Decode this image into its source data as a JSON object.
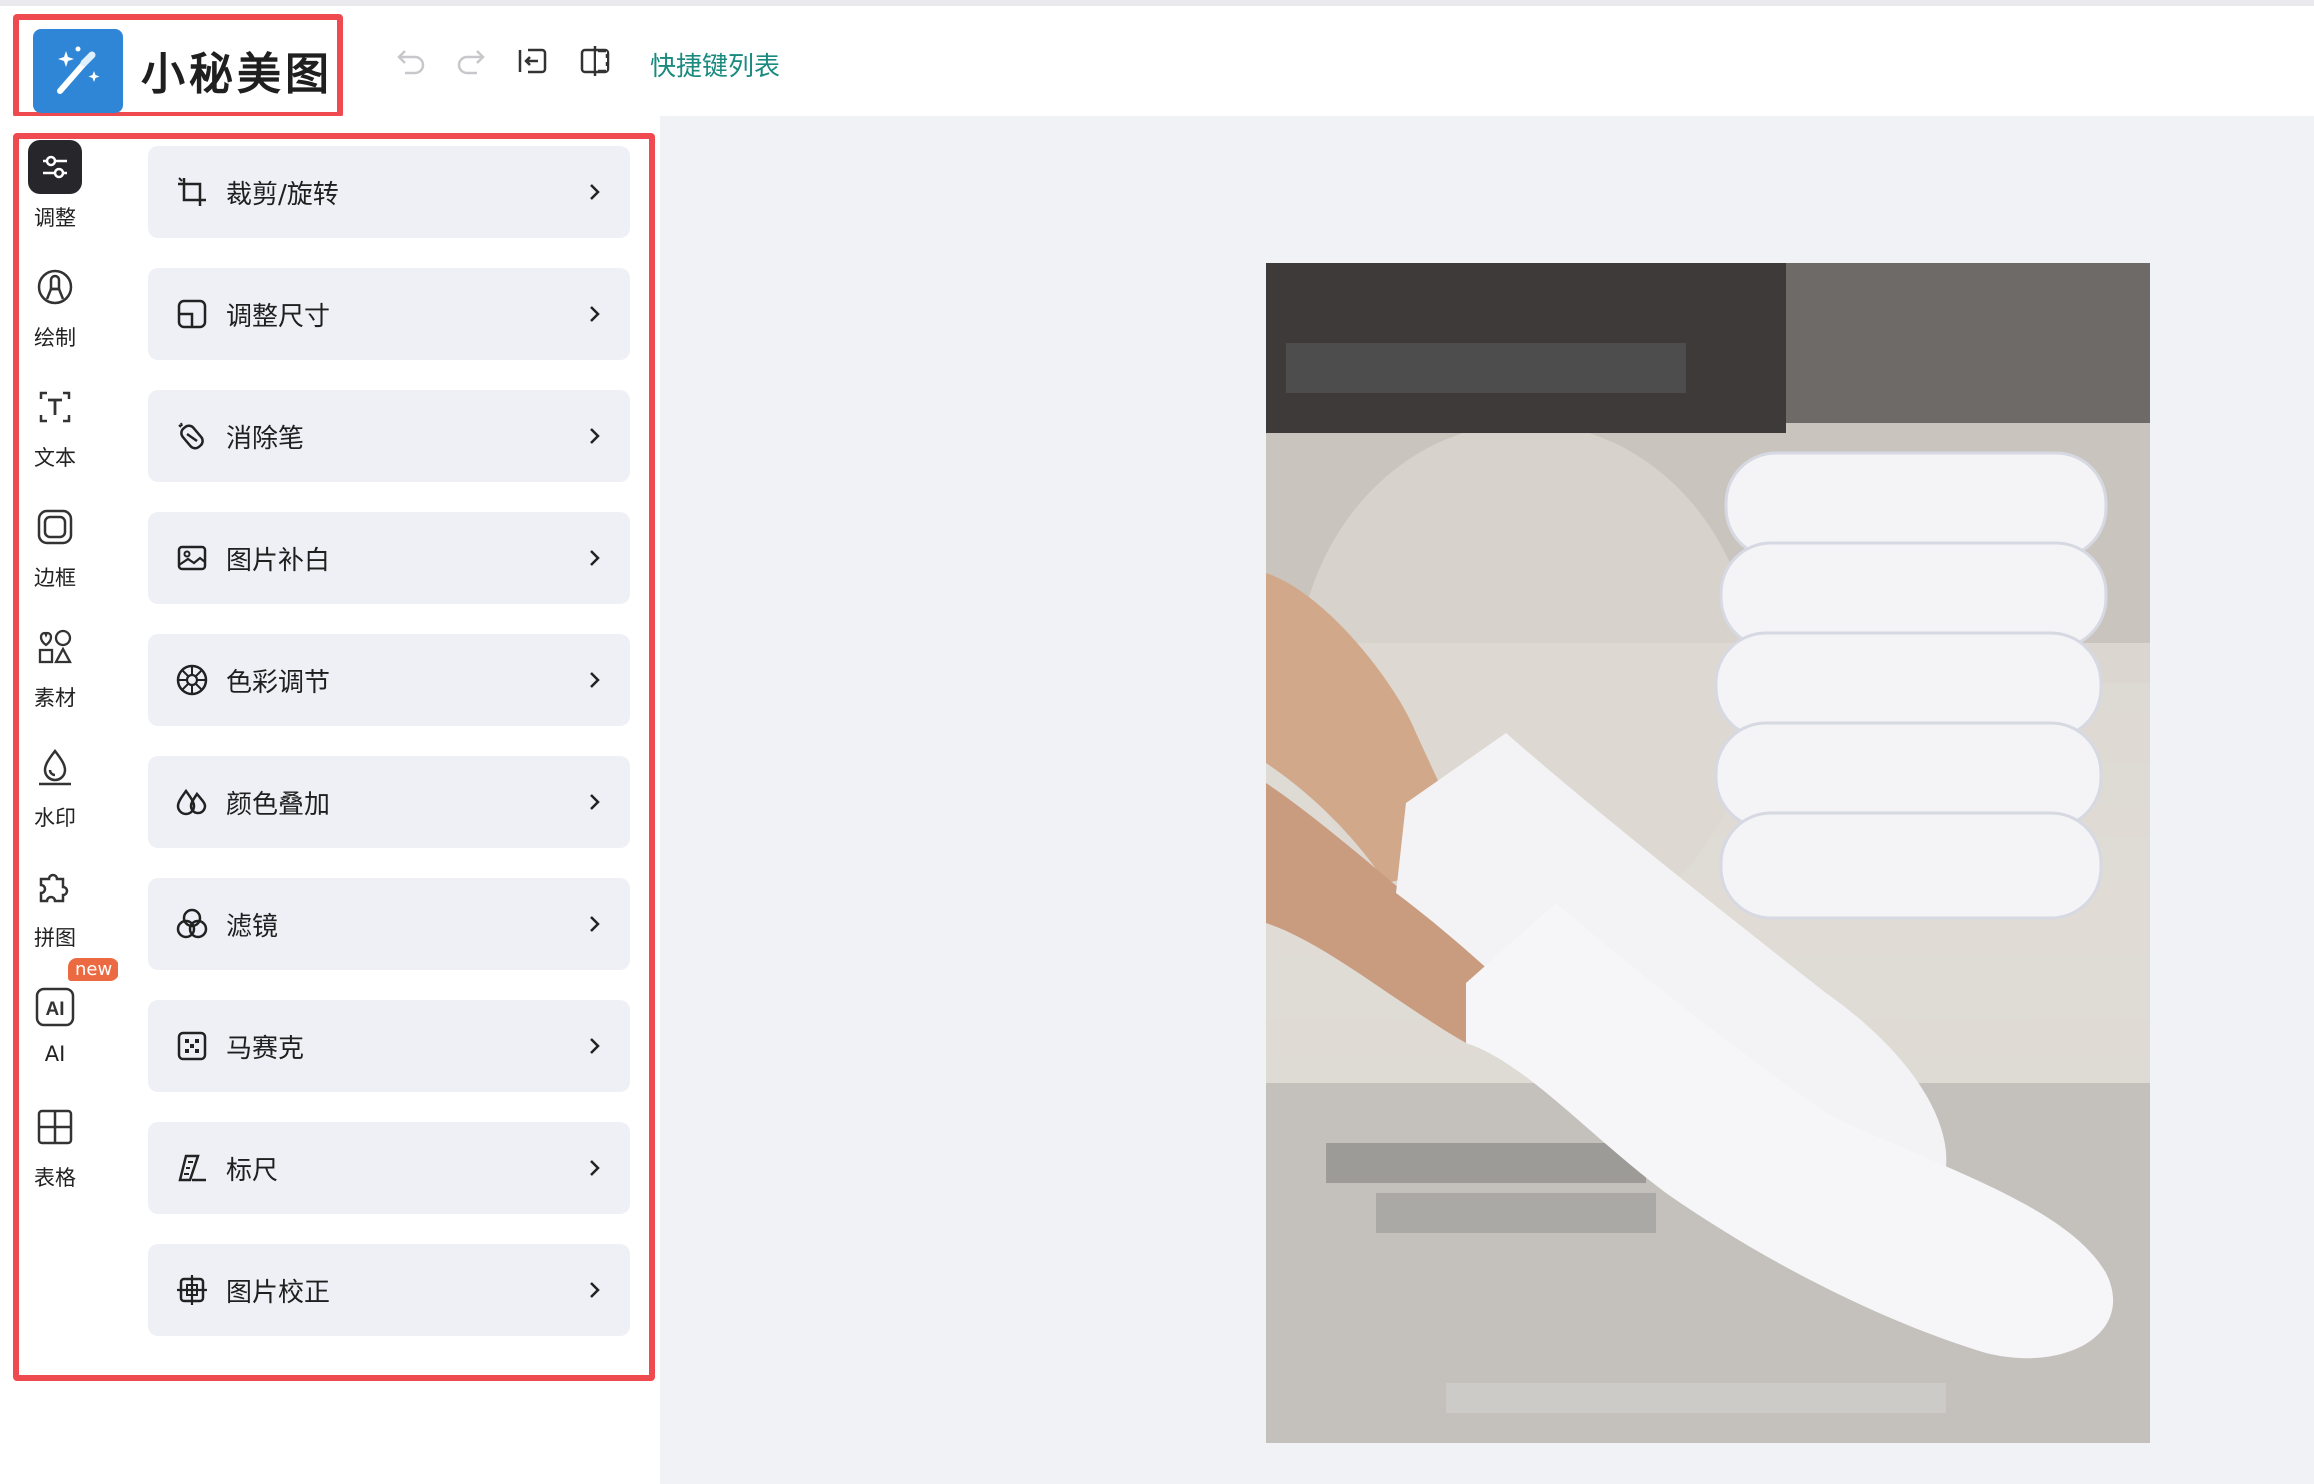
{
  "app": {
    "title": "小秘美图"
  },
  "toolbar": {
    "shortcut_link": "快捷键列表",
    "undo_icon": "undo-icon",
    "redo_icon": "redo-icon",
    "export_icon": "export-icon",
    "compare_icon": "compare-icon"
  },
  "rail": {
    "items": [
      {
        "label": "调整",
        "icon": "sliders-icon",
        "active": true
      },
      {
        "label": "绘制",
        "icon": "palette-icon"
      },
      {
        "label": "文本",
        "icon": "text-icon"
      },
      {
        "label": "边框",
        "icon": "frame-icon"
      },
      {
        "label": "素材",
        "icon": "shapes-icon"
      },
      {
        "label": "水印",
        "icon": "watermark-icon"
      },
      {
        "label": "拼图",
        "icon": "puzzle-icon"
      },
      {
        "label": "AI",
        "icon": "ai-icon",
        "badge": "new"
      },
      {
        "label": "表格",
        "icon": "table-icon"
      }
    ]
  },
  "panel": {
    "items": [
      {
        "label": "裁剪/旋转",
        "icon": "crop-icon"
      },
      {
        "label": "调整尺寸",
        "icon": "resize-icon"
      },
      {
        "label": "消除笔",
        "icon": "eraser-icon"
      },
      {
        "label": "图片补白",
        "icon": "image-pad-icon"
      },
      {
        "label": "色彩调节",
        "icon": "color-wheel-icon"
      },
      {
        "label": "颜色叠加",
        "icon": "color-overlay-icon"
      },
      {
        "label": "滤镜",
        "icon": "filter-icon"
      },
      {
        "label": "马赛克",
        "icon": "mosaic-icon"
      },
      {
        "label": "标尺",
        "icon": "ruler-icon"
      },
      {
        "label": "图片校正",
        "icon": "image-correct-icon"
      }
    ]
  },
  "colors": {
    "highlight": "#ef4a4f",
    "logo_blue": "#2f86d6",
    "link_teal": "#1a8a7e",
    "menu_bg": "#eef0f6",
    "canvas_bg": "#f1f2f6",
    "badge_orange": "#ec6a42"
  }
}
